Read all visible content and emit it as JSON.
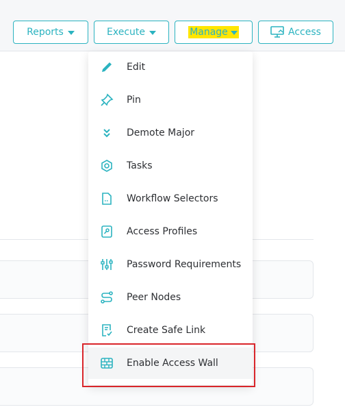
{
  "toolbar": {
    "reports_label": "Reports",
    "execute_label": "Execute",
    "manage_label": "Manage",
    "access_label": "Access"
  },
  "menu": {
    "items": [
      {
        "label": "Edit",
        "icon": "pencil-icon"
      },
      {
        "label": "Pin",
        "icon": "pin-icon"
      },
      {
        "label": "Demote Major",
        "icon": "double-chevron-down-icon"
      },
      {
        "label": "Tasks",
        "icon": "hexagon-icon"
      },
      {
        "label": "Workflow Selectors",
        "icon": "document-icon"
      },
      {
        "label": "Access Profiles",
        "icon": "key-card-icon"
      },
      {
        "label": "Password Requirements",
        "icon": "sliders-icon"
      },
      {
        "label": "Peer Nodes",
        "icon": "route-icon"
      },
      {
        "label": "Create Safe Link",
        "icon": "document-check-icon"
      },
      {
        "label": "Enable Access Wall",
        "icon": "firewall-icon"
      }
    ]
  },
  "colors": {
    "accent": "#2bb3c0",
    "highlight": "#ffe600",
    "callout": "#d9252a"
  }
}
